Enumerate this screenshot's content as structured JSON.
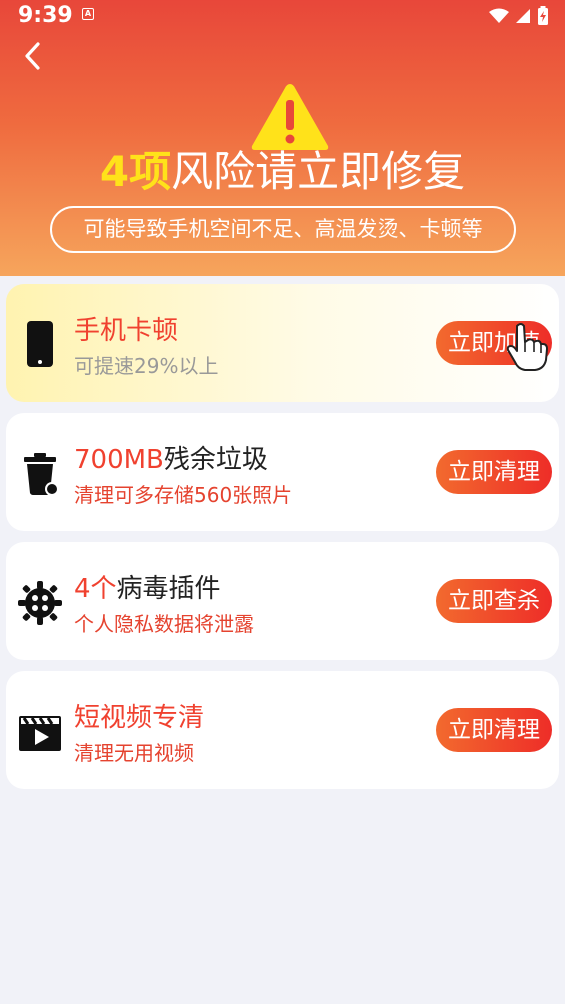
{
  "status_bar": {
    "time": "9:39",
    "notification_letter": "A"
  },
  "header": {
    "headline_count": "4项",
    "headline_text": "风险请立即修复",
    "subtitle": "可能导致手机空间不足、高温发烫、卡顿等"
  },
  "cards": [
    {
      "title_highlight": "",
      "title": "手机卡顿",
      "subtitle": "可提速29%以上",
      "button": "立即加速",
      "icon": "phone-icon"
    },
    {
      "title_highlight": "700MB",
      "title": "残余垃圾",
      "subtitle": "清理可多存储560张照片",
      "button": "立即清理",
      "icon": "trash-icon"
    },
    {
      "title_highlight": "4个",
      "title": "病毒插件",
      "subtitle": "个人隐私数据将泄露",
      "button": "立即查杀",
      "icon": "virus-icon"
    },
    {
      "title_highlight": "",
      "title": "短视频专清",
      "subtitle": "清理无用视频",
      "button": "立即清理",
      "icon": "video-clapper-icon"
    }
  ],
  "colors": {
    "header_top": "#e8473a",
    "header_bottom": "#f6a55c",
    "accent_red": "#f0412f",
    "highlight_yellow": "#ffe21a"
  }
}
